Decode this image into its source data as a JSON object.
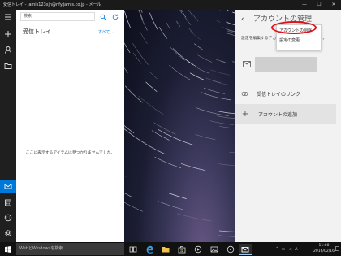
{
  "window": {
    "title": "受信トレイ - jamis123sjn@nfy.jamis.co.jp - メール",
    "controls": [
      "—",
      "☐",
      "✕"
    ]
  },
  "search": {
    "placeholder": "検索"
  },
  "folder": {
    "title": "受信トレイ",
    "filter": "すべて ⌄"
  },
  "list": {
    "empty_message": "ここに表示するアイテムは見つかりませんでした。"
  },
  "settings": {
    "heading": "アカウントの管理",
    "description": "設定を編集するアカウントを選択してください。",
    "link_inboxes": "受信トレイのリンク",
    "add_account": "アカウントの追加"
  },
  "context_menu": {
    "items": [
      "アカウントの削除",
      "設定の変更"
    ]
  },
  "taskbar": {
    "search_placeholder": "WebとWindowsを検索",
    "tray_ime": "A",
    "time": "11:08",
    "date": "2016/02/16"
  },
  "colors": {
    "accent": "#0078d7",
    "highlight_circle": "#e0121b",
    "leftbar": "#1f1f1f",
    "taskbar": "#111111"
  },
  "icons": {
    "leftbar": [
      "hamburger-icon",
      "compose-plus-icon",
      "accounts-person-icon",
      "folders-icon",
      "mail-icon",
      "calendar-icon",
      "feedback-smiley-icon",
      "settings-gear-icon"
    ],
    "taskbar": [
      "windows-start-icon",
      "task-view-icon",
      "edge-browser-icon",
      "file-explorer-icon",
      "store-icon",
      "media-icon",
      "mail-app-icon"
    ]
  }
}
